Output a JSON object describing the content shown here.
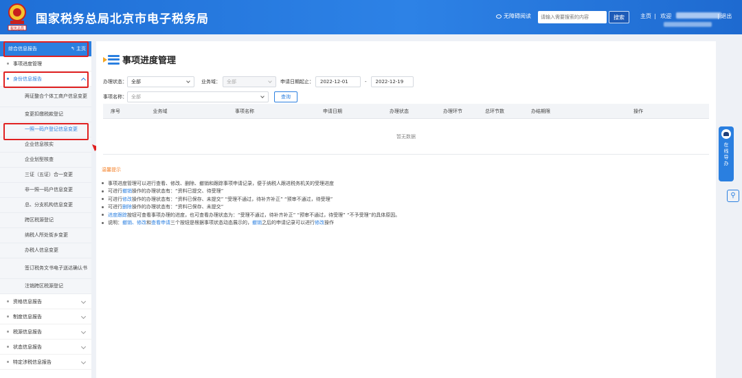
{
  "header": {
    "emblem_text": "税务总局",
    "title": "国家税务总局北京市电子税务局",
    "accessible_reading": "无障碍阅读",
    "search_placeholder": "请输入需要搜索的内容",
    "search_button": "搜索",
    "home_link": "主页",
    "welcome": "欢迎",
    "logout": "退出"
  },
  "sidebar": {
    "head_label": "综合信息报告",
    "head_home": "主页",
    "items": [
      {
        "label": "事项进度管理"
      },
      {
        "label": "身份信息报告"
      }
    ],
    "sub_items": [
      "两证整合个体工商户信息变更",
      "变更扣缴税款登记",
      "一照一码户登记信息变更",
      "企业信息核实",
      "企业划型核查",
      "三证（五证）合一变更",
      "非一照一码户信息变更",
      "总、分支机构信息变更",
      "跨区税源登记",
      "纳税人所处街乡变更",
      "办税人信息变更",
      "签订税务文书电子送达确认书",
      "注销跨区税源登记"
    ],
    "bottom_items": [
      "资格信息报告",
      "制度信息报告",
      "税源信息报告",
      "状态信息报告",
      "特定涉税信息报告"
    ]
  },
  "main": {
    "title": "事项进度管理",
    "filters": {
      "status_label": "办理状态：",
      "status_value": "全部",
      "domain_label": "业务域：",
      "domain_value": "全部",
      "date_label": "申请日期起止：",
      "date_from": "2022-12-01",
      "date_sep": "-",
      "date_to": "2022-12-19",
      "item_label": "事项名称：",
      "item_value": "全部",
      "query_button": "查询"
    },
    "table": {
      "columns": [
        "序号",
        "业务域",
        "事项名称",
        "申请日期",
        "办理状态",
        "办理环节",
        "总环节数",
        "办结期限",
        "操作"
      ],
      "empty_text": "暂无数据"
    },
    "tips": {
      "title": "温馨提示",
      "lines": [
        [
          "事项进度管理可以进行查看、修改、删除、撤销和跟踪事项申请记录，便于纳税人跟进税务机关的受理进度"
        ],
        [
          "可进行",
          "撤销",
          "操作的办理状态有：“资料已提交、待受理”"
        ],
        [
          "可进行",
          "修改",
          "操作的办理状态有：“资料已保存、未提交”  “受理不通过，待补齐补正”  “预审不通过，待受理”"
        ],
        [
          "可进行",
          "删除",
          "操作的办理状态有：“资料已保存、未提交”"
        ],
        [
          "",
          "进度跟踪",
          "按钮可查看事项办理的进度，也可查看办理状态为：“受理不通过，待补齐补正”  “预审不通过，待受理”  “不予受理”的具体原因。"
        ],
        [
          "说明：",
          "撤销、修改",
          "和",
          "查看申请",
          "三个按钮是根据事项状态动态展示的，",
          "撤销",
          "之后的申请记录可以进行",
          "修改",
          "操作"
        ]
      ]
    }
  },
  "float": {
    "help_text": [
      "在",
      "线",
      "导",
      "办"
    ]
  },
  "colors": {
    "brand_blue": "#2a7fe0",
    "header_blue": "#1f6fd6",
    "highlight_red": "#e02020",
    "tip_orange": "#f5822a"
  }
}
